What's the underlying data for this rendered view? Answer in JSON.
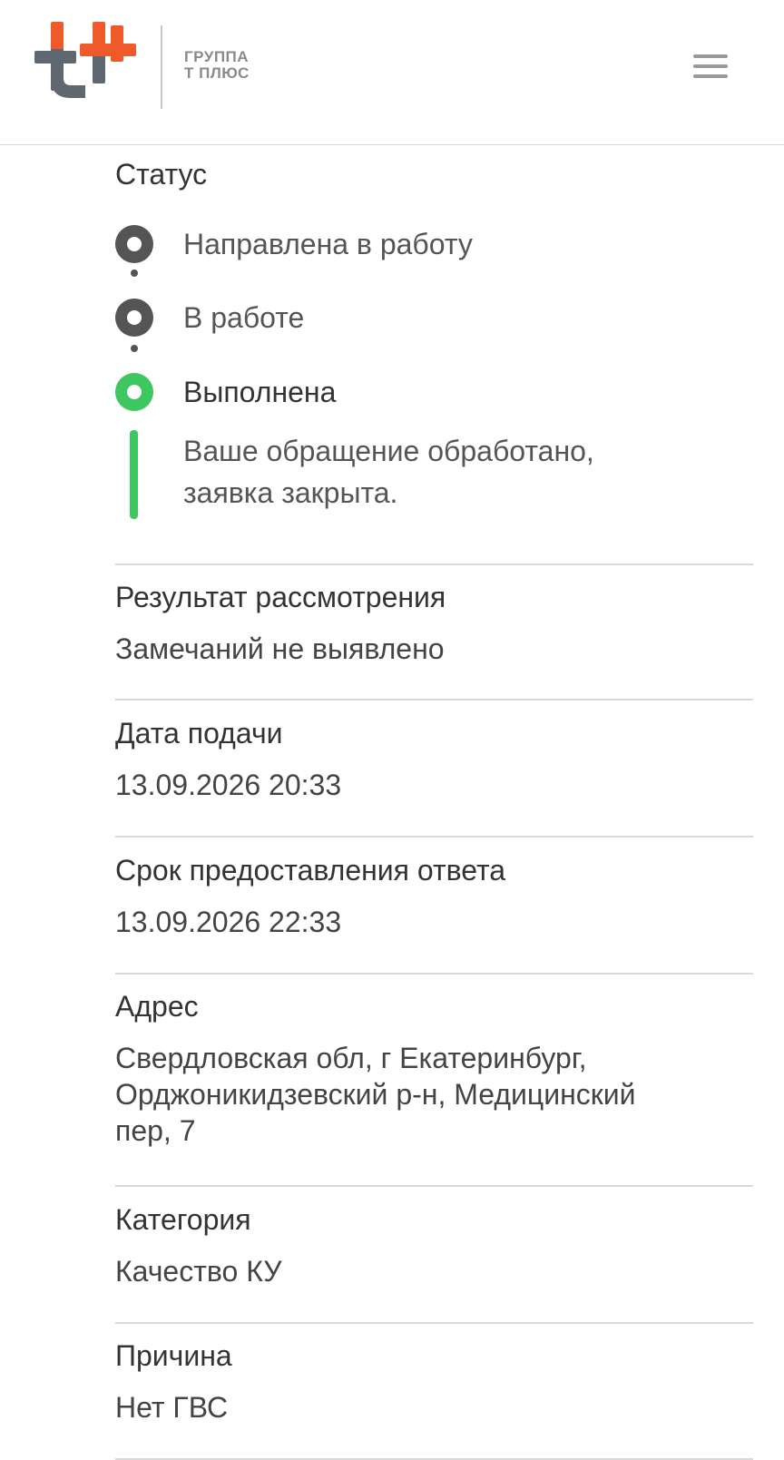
{
  "header": {
    "logo_line1": "ГРУППА",
    "logo_line2": "Т ПЛЮС",
    "brand_colors": {
      "orange": "#ee5a2a",
      "gray": "#5f6770"
    }
  },
  "status": {
    "title": "Статус",
    "steps": [
      {
        "label": "Направлена в работу",
        "state": "passed"
      },
      {
        "label": "В работе",
        "state": "passed"
      },
      {
        "label": "Выполнена",
        "state": "current"
      }
    ],
    "current_description_line1": "Ваше обращение обработано,",
    "current_description_line2": "заявка закрыта.",
    "colors": {
      "passed": "#555555",
      "current": "#3ec760"
    }
  },
  "fields": [
    {
      "label": "Результат рассмотрения",
      "value": "Замечаний не выявлено"
    },
    {
      "label": "Дата подачи",
      "value": "13.09.2026 20:33"
    },
    {
      "label": "Срок предоставления ответа",
      "value": "13.09.2026 22:33"
    },
    {
      "label": "Адрес",
      "value_line1": "Свердловская обл, г Екатеринбург,",
      "value_line2": "Орджоникидзевский р-н, Медицинский",
      "value_line3": "пер, 7"
    },
    {
      "label": "Категория",
      "value": "Качество КУ"
    },
    {
      "label": "Причина",
      "value": "Нет ГВС"
    }
  ]
}
